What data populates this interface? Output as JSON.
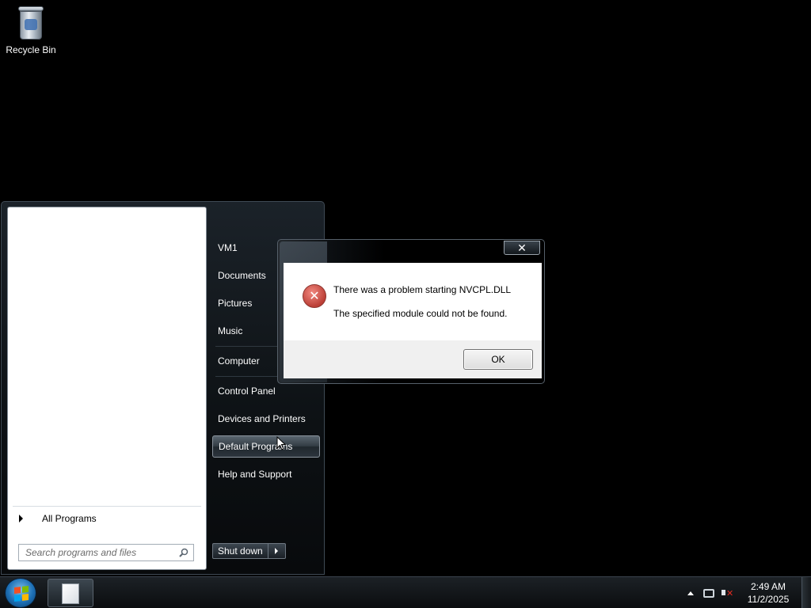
{
  "desktop": {
    "icons": [
      {
        "label": "Recycle Bin",
        "icon": "recycle-bin-icon"
      }
    ]
  },
  "start_menu": {
    "all_programs_label": "All Programs",
    "search_placeholder": "Search programs and files",
    "right_items": [
      {
        "label": "VM1"
      },
      {
        "label": "Documents"
      },
      {
        "label": "Pictures"
      },
      {
        "label": "Music"
      },
      {
        "label": "Computer"
      },
      {
        "label": "Control Panel"
      },
      {
        "label": "Devices and Printers"
      },
      {
        "label": "Default Programs",
        "highlighted": true
      },
      {
        "label": "Help and Support"
      }
    ],
    "shutdown_label": "Shut down"
  },
  "dialog": {
    "close_glyph": "✕",
    "message_line1": "There was a problem starting NVCPL.DLL",
    "message_line2": "The specified module could not be found.",
    "ok_label": "OK",
    "icon": "error-icon"
  },
  "taskbar": {
    "time": "2:49 AM",
    "date": "11/2/2025",
    "pinned": [
      {
        "icon": "document-icon"
      }
    ],
    "tray_icons": [
      "show-hidden-icons-icon",
      "network-icon",
      "volume-muted-icon"
    ]
  },
  "colors": {
    "desktop_background": "#000000",
    "error_red": "#c62a1e"
  }
}
